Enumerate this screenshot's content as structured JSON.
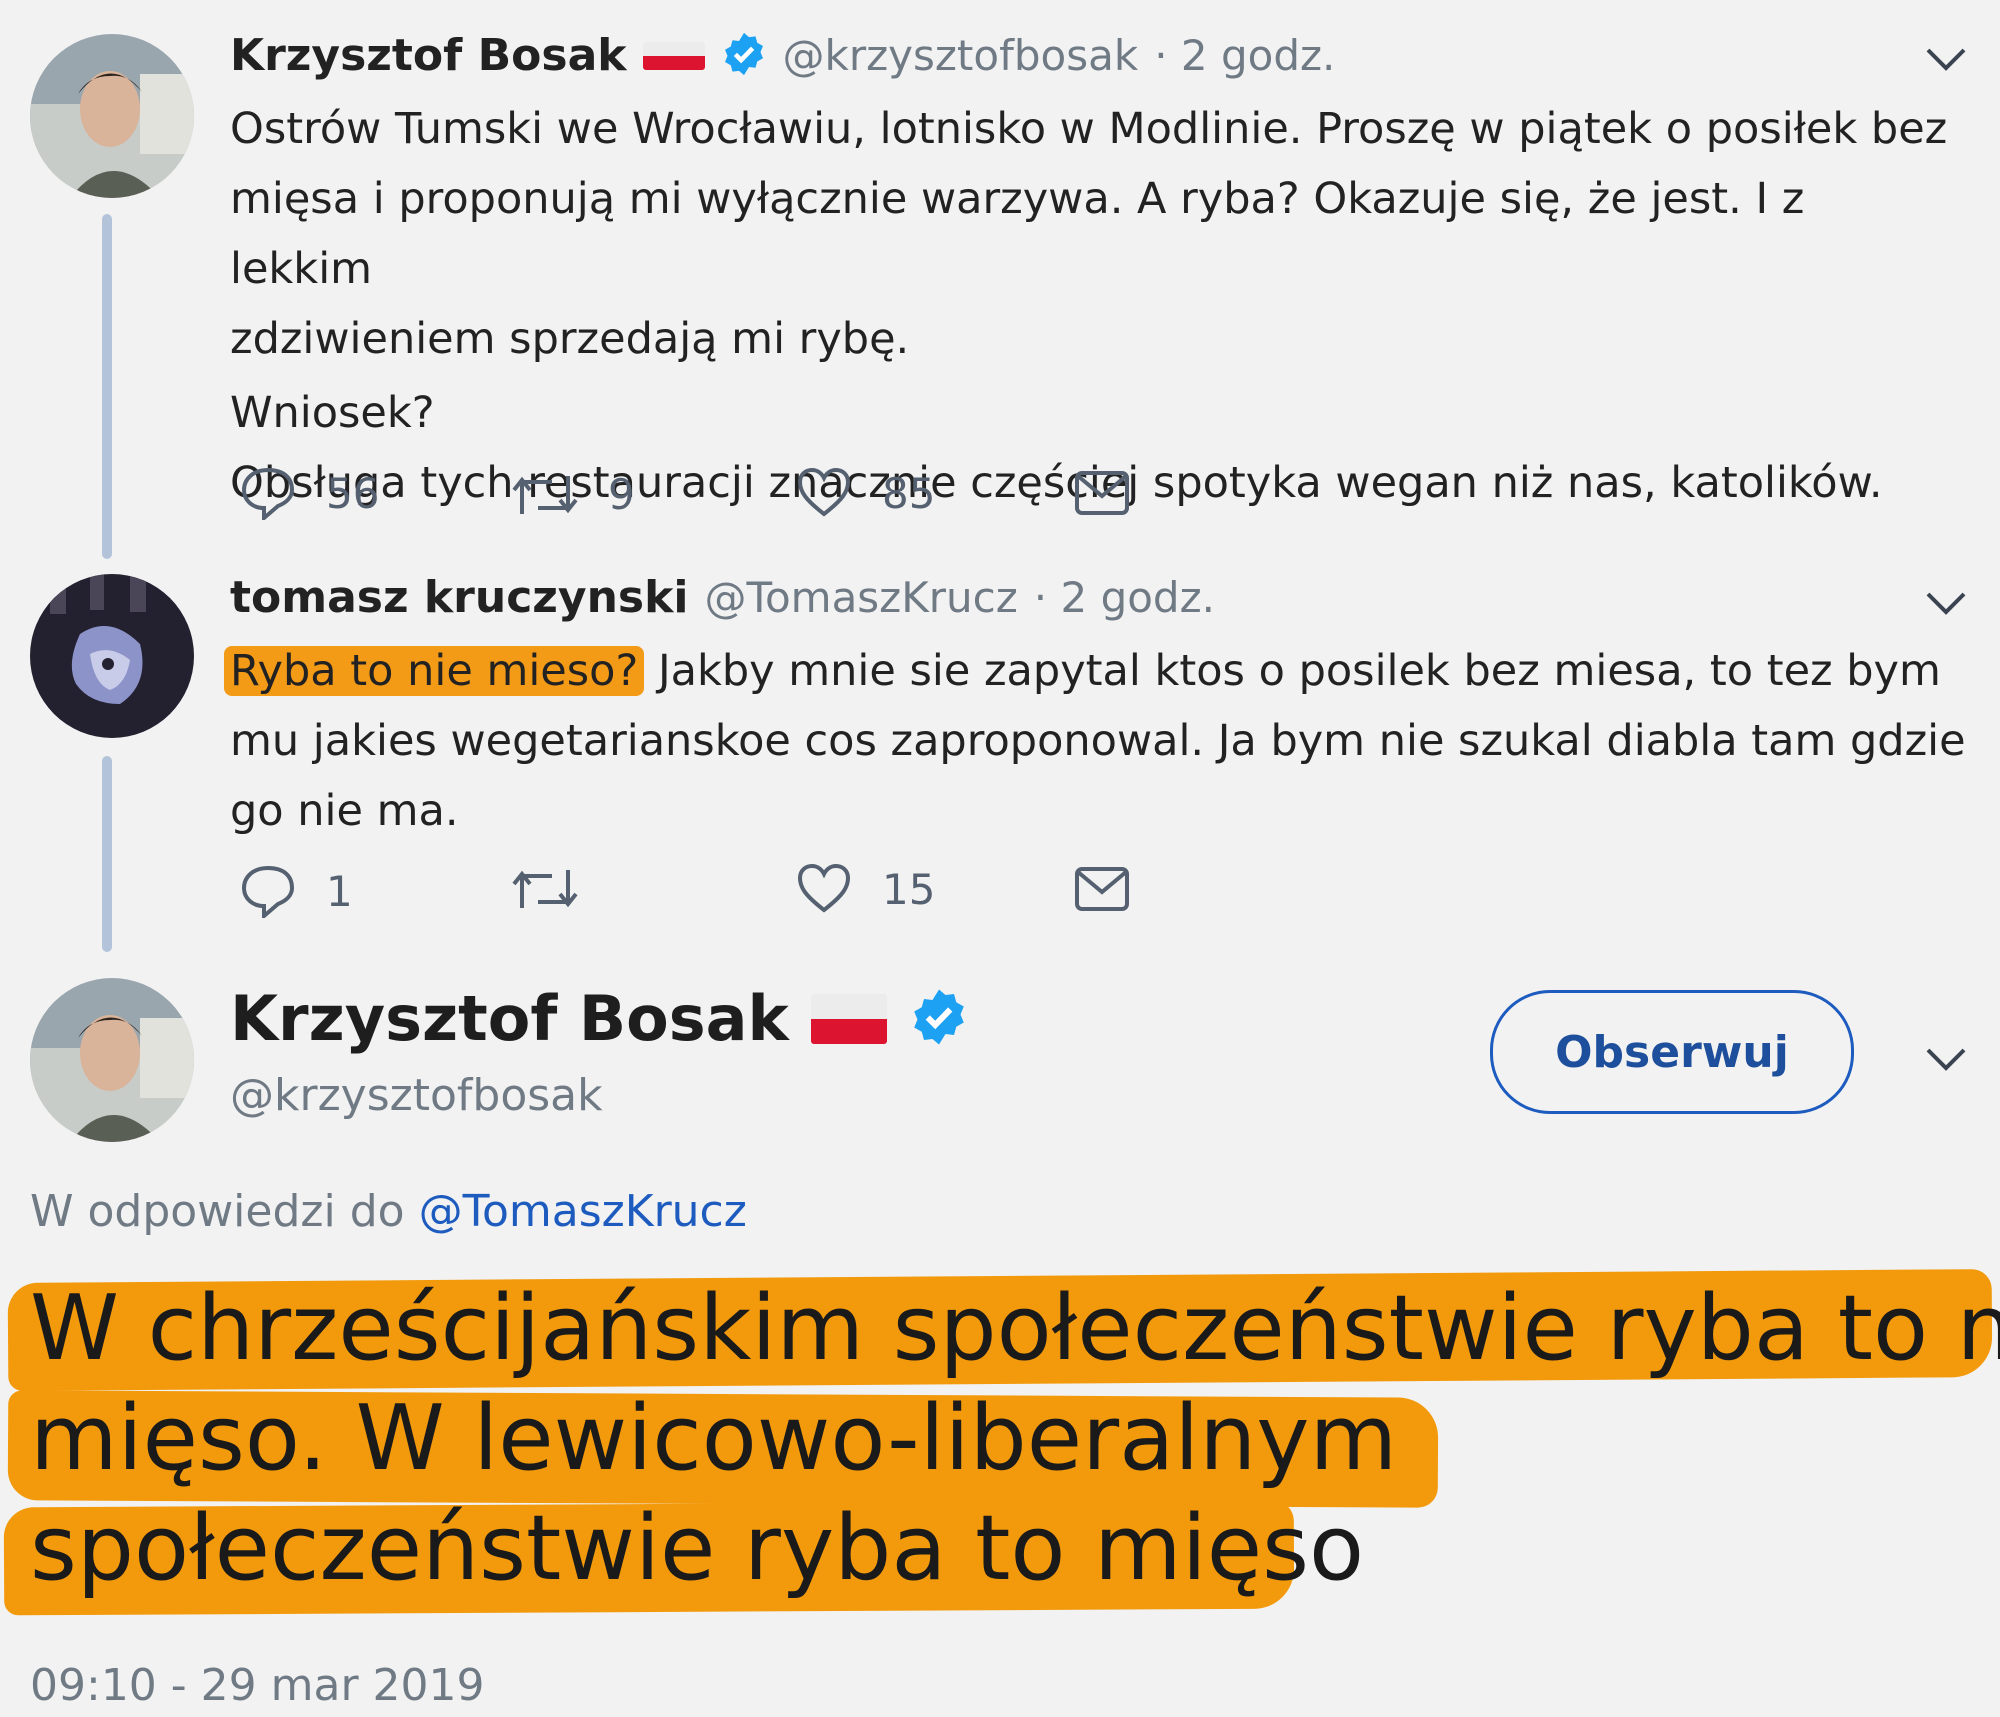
{
  "tweet1": {
    "name": "Krzysztof Bosak",
    "handle": "@krzysztofbosak",
    "time": "· 2 godz.",
    "text_lines": [
      "Ostrów Tumski we Wrocławiu, lotnisko w Modlinie. Proszę w piątek o posiłek bez",
      "mięsa i proponują mi wyłącznie warzywa. A ryba? Okazuje się, że jest. I z lekkim",
      "zdziwieniem sprzedają mi rybę.",
      "Wniosek?",
      "Obsługa tych restauracji znacznie częściej spotyka wegan niż nas, katolików."
    ],
    "replies": "56",
    "retweets": "9",
    "likes": "85"
  },
  "tweet2": {
    "name": "tomasz kruczynski",
    "handle": "@TomaszKrucz",
    "time": "· 2 godz.",
    "highlighted": "Ryba to nie mieso?",
    "text_line1_rest": " Jakby mnie sie zapytal ktos o posilek bez miesa, to tez bym",
    "text_lines": [
      "mu jakies wegetarianskoe cos zaproponowal. Ja bym nie szukal diabla tam gdzie",
      "go nie ma."
    ],
    "replies": "1",
    "retweets": "",
    "likes": "15"
  },
  "main_tweet": {
    "name": "Krzysztof Bosak",
    "handle": "@krzysztofbosak",
    "follow_label": "Obserwuj",
    "reply_to_prefix": "W odpowiedzi do",
    "reply_to_handle": "@TomaszKrucz",
    "text_lines": [
      "W chrześcijańskim społeczeństwie ryba to nie",
      "mięso. W lewicowo-liberalnym",
      "społeczeństwie ryba to mięso"
    ],
    "timestamp": "09:10 - 29 mar 2019"
  },
  "colors": {
    "highlight": "#f39a0c",
    "link": "#1d5bbf",
    "verified": "#1da1f2",
    "thread_line": "#b3c4da"
  }
}
